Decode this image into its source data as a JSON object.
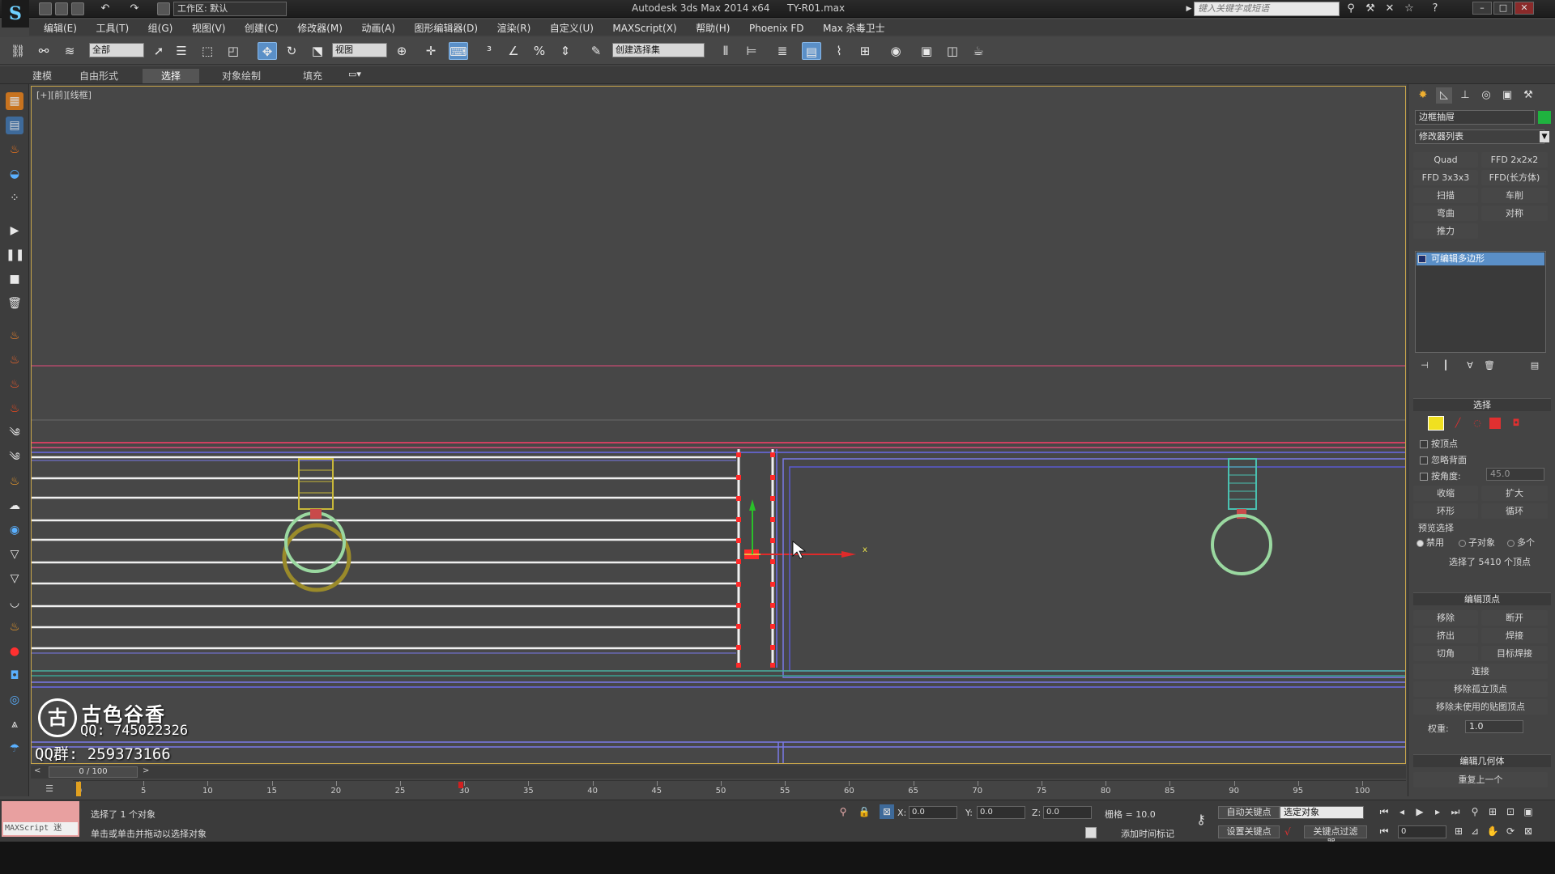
{
  "titlebar": {
    "workspace": "工作区: 默认",
    "app_title": "Autodesk 3ds Max  2014 x64",
    "file_name": "TY-R01.max",
    "search_placeholder": "键入关键字或短语"
  },
  "menu": [
    "编辑(E)",
    "工具(T)",
    "组(G)",
    "视图(V)",
    "创建(C)",
    "修改器(M)",
    "动画(A)",
    "图形编辑器(D)",
    "渲染(R)",
    "自定义(U)",
    "MAXScript(X)",
    "帮助(H)",
    "Phoenix FD",
    "Max 杀毒卫士"
  ],
  "toolbar": {
    "selection_filter": "全部",
    "ref_coord": "视图",
    "named_selection": "创建选择集"
  },
  "ribbon_tabs": [
    "建模",
    "自由形式",
    "选择",
    "对象绘制",
    "填充"
  ],
  "viewport": {
    "label": "[+][前][线框]",
    "axis_x": "x"
  },
  "watermark": {
    "logo_char": "古",
    "brand": "古色谷香",
    "qq": "QQ: 745022326",
    "qq_group": "QQ群: 259373166"
  },
  "command_panel": {
    "object_name": "边框抽屉",
    "object_color": "#1fb33f",
    "modifier_list": "修改器列表",
    "modifier_buttons": [
      "Quad Chamfer",
      "FFD 2x2x2",
      "FFD 3x3x3",
      "FFD(长方体)",
      "扫描",
      "车削",
      "弯曲",
      "对称",
      "推力"
    ],
    "stack_item": "可编辑多边形",
    "selection_section": "选择",
    "by_vertex": "按顶点",
    "ignore_backface": "忽略背面",
    "by_angle": "按角度:",
    "angle_value": "45.0",
    "shrink": "收缩",
    "grow": "扩大",
    "ring": "环形",
    "loop": "循环",
    "preview_selection": "预览选择",
    "preview_options": [
      "禁用",
      "子对象",
      "多个"
    ],
    "selected_info": "选择了 5410 个顶点",
    "edit_vertices_section": "编辑顶点",
    "remove": "移除",
    "break": "断开",
    "extrude": "挤出",
    "weld": "焊接",
    "chamfer": "切角",
    "target_weld": "目标焊接",
    "connect": "连接",
    "remove_isolated": "移除孤立顶点",
    "remove_unused_map": "移除未使用的贴图顶点",
    "weight_label": "权重:",
    "weight_value": "1.0",
    "edit_geometry_section": "编辑几何体",
    "repeat_last": "重复上一个"
  },
  "timeline": {
    "slider": "0 / 100",
    "ticks": [
      "0",
      "5",
      "10",
      "15",
      "20",
      "25",
      "30",
      "35",
      "40",
      "45",
      "50",
      "55",
      "60",
      "65",
      "70",
      "75",
      "80",
      "85",
      "90",
      "95",
      "100"
    ]
  },
  "status": {
    "maxscript_label": "MAXScript 迷",
    "selected": "选择了 1 个对象",
    "prompt": "单击或单击并拖动以选择对象",
    "x_label": "X:",
    "x_value": "0.0",
    "y_label": "Y:",
    "y_value": "0.0",
    "z_label": "Z:",
    "z_value": "0.0",
    "grid": "栅格 = 10.0",
    "auto_key": "自动关键点",
    "selected_obj": "选定对象",
    "set_key": "设置关键点",
    "key_filter": "关键点过滤器...",
    "add_time_tag": "添加时间标记",
    "frame": "0"
  }
}
